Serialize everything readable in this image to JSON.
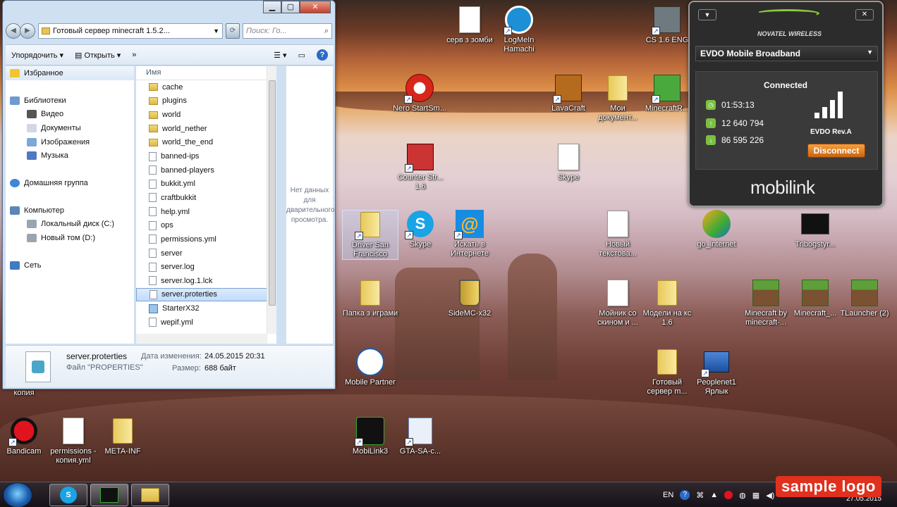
{
  "explorer": {
    "address_path": "Готовый сервер minecraft 1.5.2...",
    "search_placeholder": "Поиск: Го...",
    "toolbar": {
      "organize": "Упорядочить",
      "open": "Открыть",
      "more": "»"
    },
    "column_header": "Имя",
    "nav": [
      {
        "label": "Избранное",
        "icon": "star-icon"
      },
      {
        "label": "Библиотеки",
        "icon": "library-icon"
      },
      {
        "label": "Видео",
        "icon": "video-icon"
      },
      {
        "label": "Документы",
        "icon": "documents-icon"
      },
      {
        "label": "Изображения",
        "icon": "pictures-icon"
      },
      {
        "label": "Музыка",
        "icon": "music-icon"
      },
      {
        "label": "Домашняя группа",
        "icon": "homegroup-icon"
      },
      {
        "label": "Компьютер",
        "icon": "computer-icon"
      },
      {
        "label": "Локальный диск (C:)",
        "icon": "drive-icon"
      },
      {
        "label": "Новый том (D:)",
        "icon": "drive-icon"
      },
      {
        "label": "Сеть",
        "icon": "network-icon"
      }
    ],
    "files": [
      {
        "name": "cache",
        "type": "folder"
      },
      {
        "name": "plugins",
        "type": "folder"
      },
      {
        "name": "world",
        "type": "folder"
      },
      {
        "name": "world_nether",
        "type": "folder"
      },
      {
        "name": "world_the_end",
        "type": "folder"
      },
      {
        "name": "banned-ips",
        "type": "file"
      },
      {
        "name": "banned-players",
        "type": "file"
      },
      {
        "name": "bukkit.yml",
        "type": "file"
      },
      {
        "name": "craftbukkit",
        "type": "file"
      },
      {
        "name": "help.yml",
        "type": "file"
      },
      {
        "name": "ops",
        "type": "file"
      },
      {
        "name": "permissions.yml",
        "type": "file"
      },
      {
        "name": "server",
        "type": "file"
      },
      {
        "name": "server.log",
        "type": "file"
      },
      {
        "name": "server.log.1.lck",
        "type": "file"
      },
      {
        "name": "server.proterties",
        "type": "file",
        "selected": true
      },
      {
        "name": "StarterX32",
        "type": "script"
      },
      {
        "name": "wepif.yml",
        "type": "file"
      }
    ],
    "preview_text": "Нет данных для дварительного просмотра.",
    "details": {
      "filename": "server.proterties",
      "filetype": "Файл \"PROPERTIES\"",
      "modified_label": "Дата изменения:",
      "modified_value": "24.05.2015 20:31",
      "size_label": "Размер:",
      "size_value": "688 байт"
    }
  },
  "desktop_icons": [
    {
      "label": "серв з зомби",
      "icon": "document-icon"
    },
    {
      "label": "LogMeIn Hamachi",
      "icon": "hamachi-icon"
    },
    {
      "label": "CS 1.6 ENG",
      "icon": "cs-icon"
    },
    {
      "label": "Nero StartSm...",
      "icon": "nero-icon"
    },
    {
      "label": "LavaCraft",
      "icon": "lavacraft-icon"
    },
    {
      "label": "Мои документ...",
      "icon": "folder-icon"
    },
    {
      "label": "MinecraftR...",
      "icon": "creeper-icon"
    },
    {
      "label": "Counter Str... 1.6",
      "icon": "cs-icon"
    },
    {
      "label": "Skype",
      "icon": "document-icon"
    },
    {
      "label": "Driver San Francisco",
      "icon": "folder-icon"
    },
    {
      "label": "Skype",
      "icon": "skype-icon"
    },
    {
      "label": "Искать в Интернете",
      "icon": "mail-ru-icon"
    },
    {
      "label": "Новый текстова...",
      "icon": "document-icon"
    },
    {
      "label": "go_internet",
      "icon": "go-internet-icon"
    },
    {
      "label": "Tribogstyr...",
      "icon": "video-file-icon"
    },
    {
      "label": "Папка з играми",
      "icon": "folder-icon"
    },
    {
      "label": "SideMC-x32",
      "icon": "bucket-icon"
    },
    {
      "label": "Мойник со скином и ...",
      "icon": "document-icon"
    },
    {
      "label": "Модели на кс 1.6",
      "icon": "folder-icon"
    },
    {
      "label": "Minecraft by minecraft-...",
      "icon": "grass-block-icon"
    },
    {
      "label": "Minecraft_...",
      "icon": "grass-block-icon"
    },
    {
      "label": "TLauncher (2)",
      "icon": "grass-block-icon"
    },
    {
      "label": "Mobile Partner",
      "icon": "people-icon"
    },
    {
      "label": "Готовый сервер m...",
      "icon": "folder-icon"
    },
    {
      "label": "Peoplenet1 Ярлык",
      "icon": "network-computers-icon"
    },
    {
      "label": "копия",
      "icon": "none"
    },
    {
      "label": "Bandicam",
      "icon": "bandicam-icon"
    },
    {
      "label": "permissions - копия.yml",
      "icon": "document-icon"
    },
    {
      "label": "META-INF",
      "icon": "folder-icon"
    },
    {
      "label": "MobiLink3",
      "icon": "mobilink-icon"
    },
    {
      "label": "GTA-SA-c...",
      "icon": "document-icon"
    }
  ],
  "mobilink": {
    "brand": "NOVATEL WIRELESS",
    "connection_name": "EVDO Mobile Broadband",
    "status": "Connected",
    "duration": "01:53:13",
    "sent": "12 640 794",
    "received": "86 595 226",
    "network_type": "EVDO Rev.A",
    "disconnect_label": "Disconnect",
    "logo": "mobilink",
    "signal_bars": 4
  },
  "taskbar": {
    "language": "EN",
    "date": "27.05.2015",
    "watermark": "sample logo"
  }
}
